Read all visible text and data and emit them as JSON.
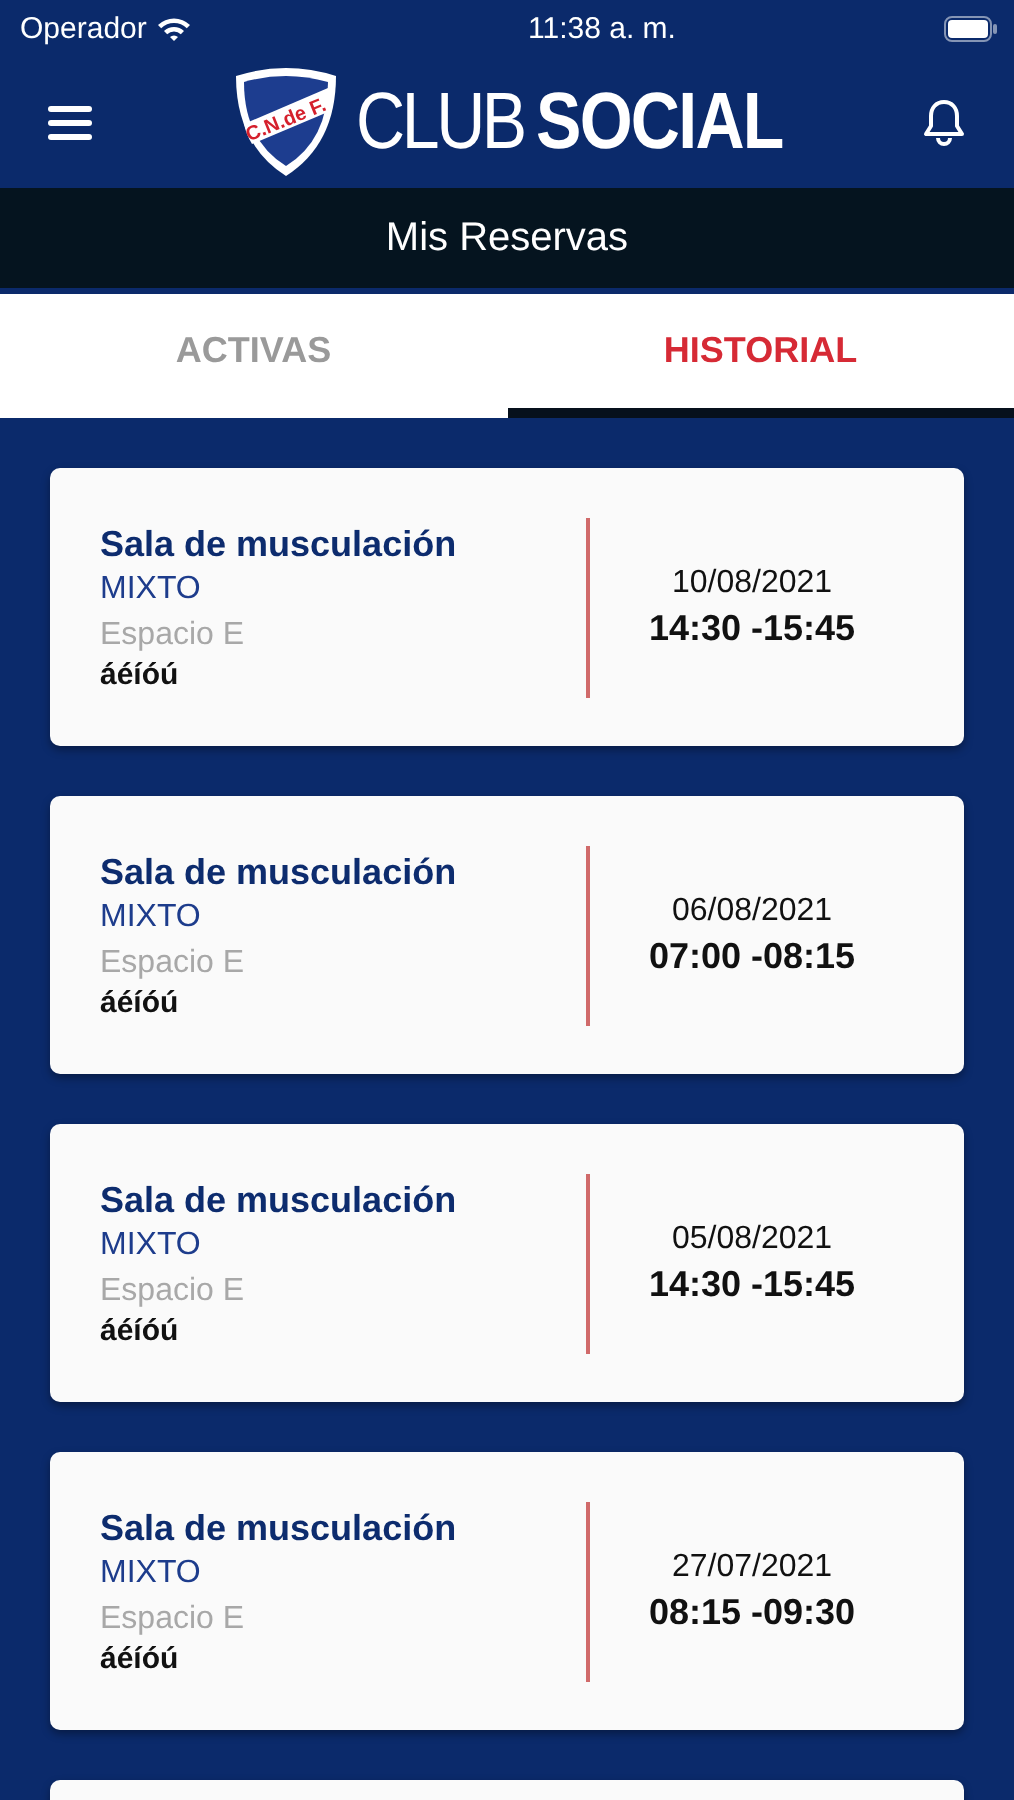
{
  "status_bar": {
    "carrier": "Operador",
    "time": "11:38 a. m."
  },
  "header": {
    "logo": {
      "badge": "C.N.de F.",
      "light": "CLUB",
      "bold": "SOCIAL"
    }
  },
  "title": "Mis Reservas",
  "tabs": [
    {
      "label": "ACTIVAS",
      "selected": false
    },
    {
      "label": "HISTORIAL",
      "selected": true
    }
  ],
  "reservations": [
    {
      "name": "Sala de musculación",
      "type": "MIXTO",
      "space": "Espacio E",
      "note": "áéíóú",
      "date": "10/08/2021",
      "time": "14:30 -15:45"
    },
    {
      "name": "Sala de musculación",
      "type": "MIXTO",
      "space": "Espacio E",
      "note": "áéíóú",
      "date": "06/08/2021",
      "time": "07:00 -08:15"
    },
    {
      "name": "Sala de musculación",
      "type": "MIXTO",
      "space": "Espacio E",
      "note": "áéíóú",
      "date": "05/08/2021",
      "time": "14:30 -15:45"
    },
    {
      "name": "Sala de musculación",
      "type": "MIXTO",
      "space": "Espacio E",
      "note": "áéíóú",
      "date": "27/07/2021",
      "time": "08:15 -09:30"
    }
  ]
}
